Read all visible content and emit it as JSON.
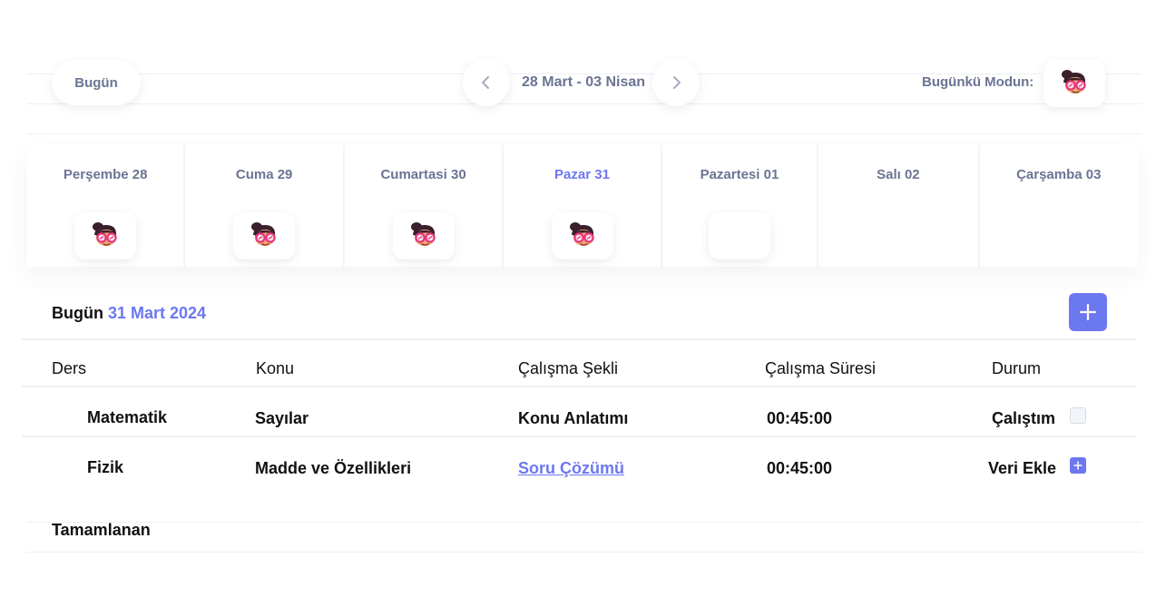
{
  "toolbar": {
    "today_label": "Bugün",
    "range_label": "28 Mart - 03 Nisan",
    "mood_label": "Bugünkü Modun:",
    "prev_icon": "chevron-left-icon",
    "next_icon": "chevron-right-icon",
    "mood_icon": "girl-with-glasses-emoji-icon"
  },
  "days": [
    {
      "label": "Perşembe 28",
      "mood": "girl-with-glasses-emoji-icon",
      "active": false
    },
    {
      "label": "Cuma 29",
      "mood": "girl-with-glasses-emoji-icon",
      "active": false
    },
    {
      "label": "Cumartasi 30",
      "mood": "girl-with-glasses-emoji-icon",
      "active": false
    },
    {
      "label": "Pazar 31",
      "mood": "girl-with-glasses-emoji-icon",
      "active": true
    },
    {
      "label": "Pazartesi 01",
      "mood": "empty",
      "active": false
    },
    {
      "label": "Salı 02",
      "mood": "none",
      "active": false
    },
    {
      "label": "Çarşamba 03",
      "mood": "none",
      "active": false
    }
  ],
  "today_section": {
    "prefix": "Bugün",
    "date": "31 Mart 2024",
    "add_icon": "plus-icon"
  },
  "table": {
    "headers": [
      "Ders",
      "Konu",
      "Çalışma Şekli",
      "Çalışma Süresi",
      "Durum"
    ],
    "rows": [
      {
        "ders": "Matematik",
        "konu": "Sayılar",
        "sekil": "Konu Anlatımı",
        "sure": "00:45:00",
        "durum": "Çalıştım",
        "action": "checkbox"
      },
      {
        "ders": "Fizik",
        "konu": "Madde ve Özellikleri",
        "sekil": "Soru Çözümü",
        "sure": "00:45:00",
        "durum": "Veri Ekle",
        "action": "add"
      }
    ]
  },
  "completed_label": "Tamamlanan",
  "colors": {
    "accent": "#6c78f0",
    "muted_text": "#6b7493",
    "mood_pink": "#e6357a",
    "mood_hair": "#3a1f2c"
  }
}
